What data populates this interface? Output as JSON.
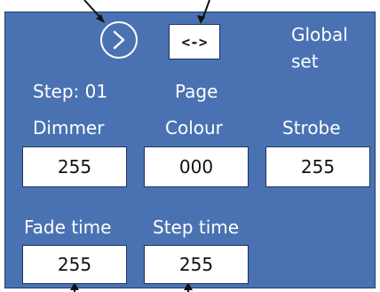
{
  "nav": {
    "next_icon": "chevron-right-circle-icon",
    "page_button_label": "<->",
    "page_label": "Page"
  },
  "global": {
    "line1": "Global",
    "line2": "set"
  },
  "step": {
    "label": "Step: 01"
  },
  "fields": {
    "dimmer": {
      "label": "Dimmer",
      "value": "255"
    },
    "colour": {
      "label": "Colour",
      "value": "000"
    },
    "strobe": {
      "label": "Strobe",
      "value": "255"
    },
    "fade_time": {
      "label": "Fade time",
      "value": "255"
    },
    "step_time": {
      "label": "Step time",
      "value": "255"
    }
  },
  "colors": {
    "panel": "#4a72b2",
    "text": "#ffffff",
    "box": "#ffffff"
  }
}
